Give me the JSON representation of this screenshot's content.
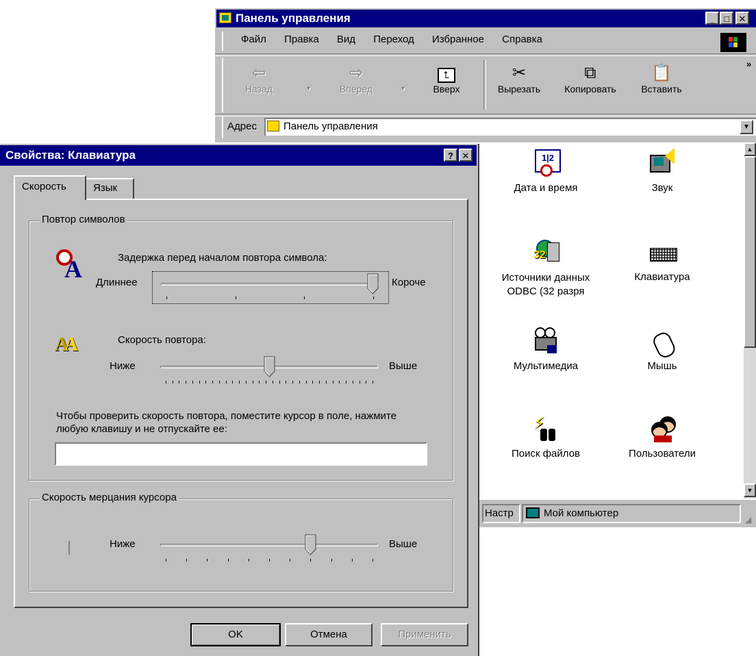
{
  "cp": {
    "title": "Панель управления",
    "menu": [
      "Файл",
      "Правка",
      "Вид",
      "Переход",
      "Избранное",
      "Справка"
    ],
    "toolbar": {
      "back": "Назад",
      "forward": "Вперед",
      "up": "Вверх",
      "cut": "Вырезать",
      "copy": "Копировать",
      "paste": "Вставить"
    },
    "address_label": "Адрес",
    "address_value": "Панель управления",
    "items": [
      {
        "label": "Дата и время",
        "icon": "calendar-clock-icon"
      },
      {
        "label": "Звук",
        "icon": "speaker-icon"
      },
      {
        "label": "Источники данных ODBC (32 разря",
        "icon": "odbc-icon"
      },
      {
        "label": "Клавиатура",
        "icon": "keyboard-icon"
      },
      {
        "label": "Мультимедиа",
        "icon": "multimedia-icon"
      },
      {
        "label": "Мышь",
        "icon": "mouse-icon"
      },
      {
        "label": "Поиск файлов",
        "icon": "find-files-icon"
      },
      {
        "label": "Пользователи",
        "icon": "users-icon"
      }
    ],
    "status_left": "Настр",
    "status_right": "Мой компьютер"
  },
  "dlg": {
    "title": "Свойства: Клавиатура",
    "help_btn": "?",
    "close_btn": "✕",
    "tabs": [
      "Скорость",
      "Язык"
    ],
    "group1": "Повтор символов",
    "delay_label": "Задержка перед началом повтора символа:",
    "delay_left": "Длиннее",
    "delay_right": "Короче",
    "delay_value": 1.0,
    "rate_label": "Скорость повтора:",
    "rate_left": "Ниже",
    "rate_right": "Выше",
    "rate_value": 0.5,
    "test_label": "Чтобы проверить скорость повтора, поместите курсор в поле, нажмите любую клавишу и не отпускайте ее:",
    "test_value": "",
    "group2": "Скорость мерцания курсора",
    "blink_left": "Ниже",
    "blink_right": "Выше",
    "blink_value": 0.7,
    "ok": "OK",
    "cancel": "Отмена",
    "apply": "Применить"
  }
}
